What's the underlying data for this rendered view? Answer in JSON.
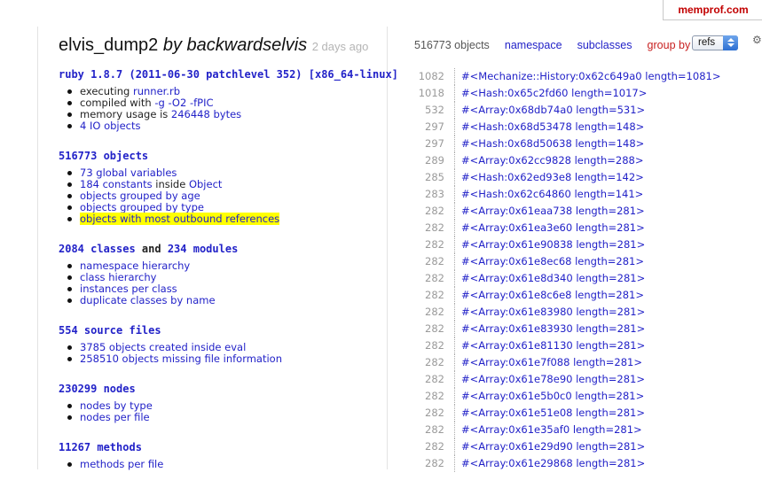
{
  "brand": "memprof.com",
  "dump": {
    "name": "elvis_dump2",
    "by_text": "by backwardselvis",
    "age": "2 days ago"
  },
  "sections": {
    "ruby": {
      "heading": "ruby 1.8.7 (2011-06-30 patchlevel 352) [x86_64-linux]",
      "executing_label": "executing ",
      "executing_value": "runner.rb",
      "compiled_label": "compiled with ",
      "compiled_value": "-g -O2 -fPIC",
      "memory_label": "memory usage is ",
      "memory_value": "246448 bytes",
      "io": "4 IO objects"
    },
    "objects": {
      "heading": "516773 objects",
      "globals": "73 global variables",
      "constants_link": "184 constants",
      "constants_mid": " inside ",
      "constants_obj": "Object",
      "by_age": "objects grouped by age",
      "by_type": "objects grouped by type",
      "outbound": "objects with most outbound references"
    },
    "classes": {
      "count1": "2084 classes",
      "and": " and ",
      "count2": "234 modules",
      "items": [
        "namespace hierarchy",
        "class hierarchy",
        "instances per class",
        "duplicate classes by name"
      ]
    },
    "source": {
      "heading": "554 source files",
      "items": [
        "3785 objects created inside eval",
        "258510 objects missing file information"
      ]
    },
    "nodes": {
      "heading": "230299 nodes",
      "items": [
        "nodes by type",
        "nodes per file"
      ]
    },
    "methods": {
      "heading": "11267 methods",
      "items": [
        "methods per file"
      ]
    }
  },
  "toolbar": {
    "count": "516773 objects",
    "namespace": "namespace",
    "subclasses": "subclasses",
    "group_by": "group by",
    "select_value": "refs"
  },
  "refs": [
    {
      "n": "1082",
      "t": "#<Mechanize::History:0x62c649a0 length=1081>"
    },
    {
      "n": "1018",
      "t": "#<Hash:0x65c2fd60 length=1017>"
    },
    {
      "n": "532",
      "t": "#<Array:0x68db74a0 length=531>"
    },
    {
      "n": "297",
      "t": "#<Hash:0x68d53478 length=148>"
    },
    {
      "n": "297",
      "t": "#<Hash:0x68d50638 length=148>"
    },
    {
      "n": "289",
      "t": "#<Array:0x62cc9828 length=288>"
    },
    {
      "n": "285",
      "t": "#<Hash:0x62ed93e8 length=142>"
    },
    {
      "n": "283",
      "t": "#<Hash:0x62c64860 length=141>"
    },
    {
      "n": "282",
      "t": "#<Array:0x61eaa738 length=281>"
    },
    {
      "n": "282",
      "t": "#<Array:0x61ea3e60 length=281>"
    },
    {
      "n": "282",
      "t": "#<Array:0x61e90838 length=281>"
    },
    {
      "n": "282",
      "t": "#<Array:0x61e8ec68 length=281>"
    },
    {
      "n": "282",
      "t": "#<Array:0x61e8d340 length=281>"
    },
    {
      "n": "282",
      "t": "#<Array:0x61e8c6e8 length=281>"
    },
    {
      "n": "282",
      "t": "#<Array:0x61e83980 length=281>"
    },
    {
      "n": "282",
      "t": "#<Array:0x61e83930 length=281>"
    },
    {
      "n": "282",
      "t": "#<Array:0x61e81130 length=281>"
    },
    {
      "n": "282",
      "t": "#<Array:0x61e7f088 length=281>"
    },
    {
      "n": "282",
      "t": "#<Array:0x61e78e90 length=281>"
    },
    {
      "n": "282",
      "t": "#<Array:0x61e5b0c0 length=281>"
    },
    {
      "n": "282",
      "t": "#<Array:0x61e51e08 length=281>"
    },
    {
      "n": "282",
      "t": "#<Array:0x61e35af0 length=281>"
    },
    {
      "n": "282",
      "t": "#<Array:0x61e29d90 length=281>"
    },
    {
      "n": "282",
      "t": "#<Array:0x61e29868 length=281>"
    }
  ]
}
